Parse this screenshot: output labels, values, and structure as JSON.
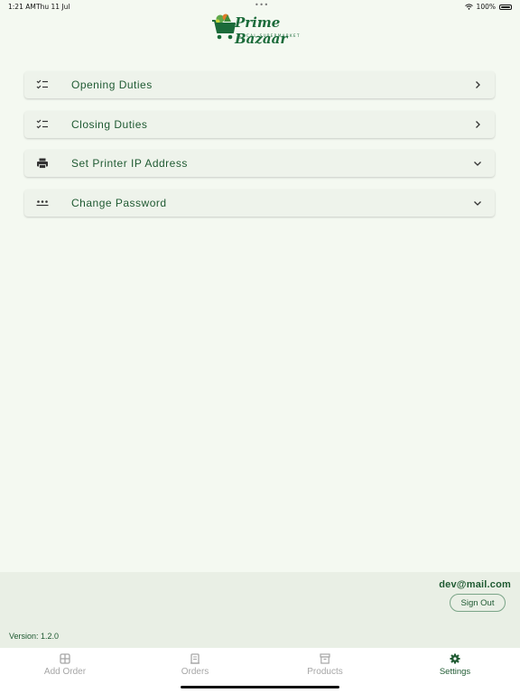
{
  "status_bar": {
    "time": "1:21 AM",
    "date": "Thu 11 Jul",
    "dots": "•••",
    "battery": "100%"
  },
  "logo": {
    "title": "Prime Bazaar",
    "subtitle": "LOCAL SUPERMARKET"
  },
  "menu": [
    {
      "label": "Opening Duties",
      "icon": "checklist-icon",
      "trail": "chevron-right-icon"
    },
    {
      "label": "Closing Duties",
      "icon": "checklist-icon",
      "trail": "chevron-right-icon"
    },
    {
      "label": "Set Printer IP Address",
      "icon": "printer-icon",
      "trail": "chevron-down-icon"
    },
    {
      "label": "Change Password",
      "icon": "password-icon",
      "trail": "chevron-down-icon"
    }
  ],
  "account": {
    "email": "dev@mail.com",
    "sign_out": "Sign Out"
  },
  "version": "Version: 1.2.0",
  "tabs": [
    {
      "label": "Add Order",
      "icon": "add-order-icon"
    },
    {
      "label": "Orders",
      "icon": "orders-icon"
    },
    {
      "label": "Products",
      "icon": "products-icon"
    },
    {
      "label": "Settings",
      "icon": "settings-icon",
      "active": true
    }
  ],
  "colors": {
    "accent": "#1f5a32",
    "background": "#f4f9f1",
    "card": "#eef3eb",
    "inactive_tab": "#a6a6a6"
  }
}
